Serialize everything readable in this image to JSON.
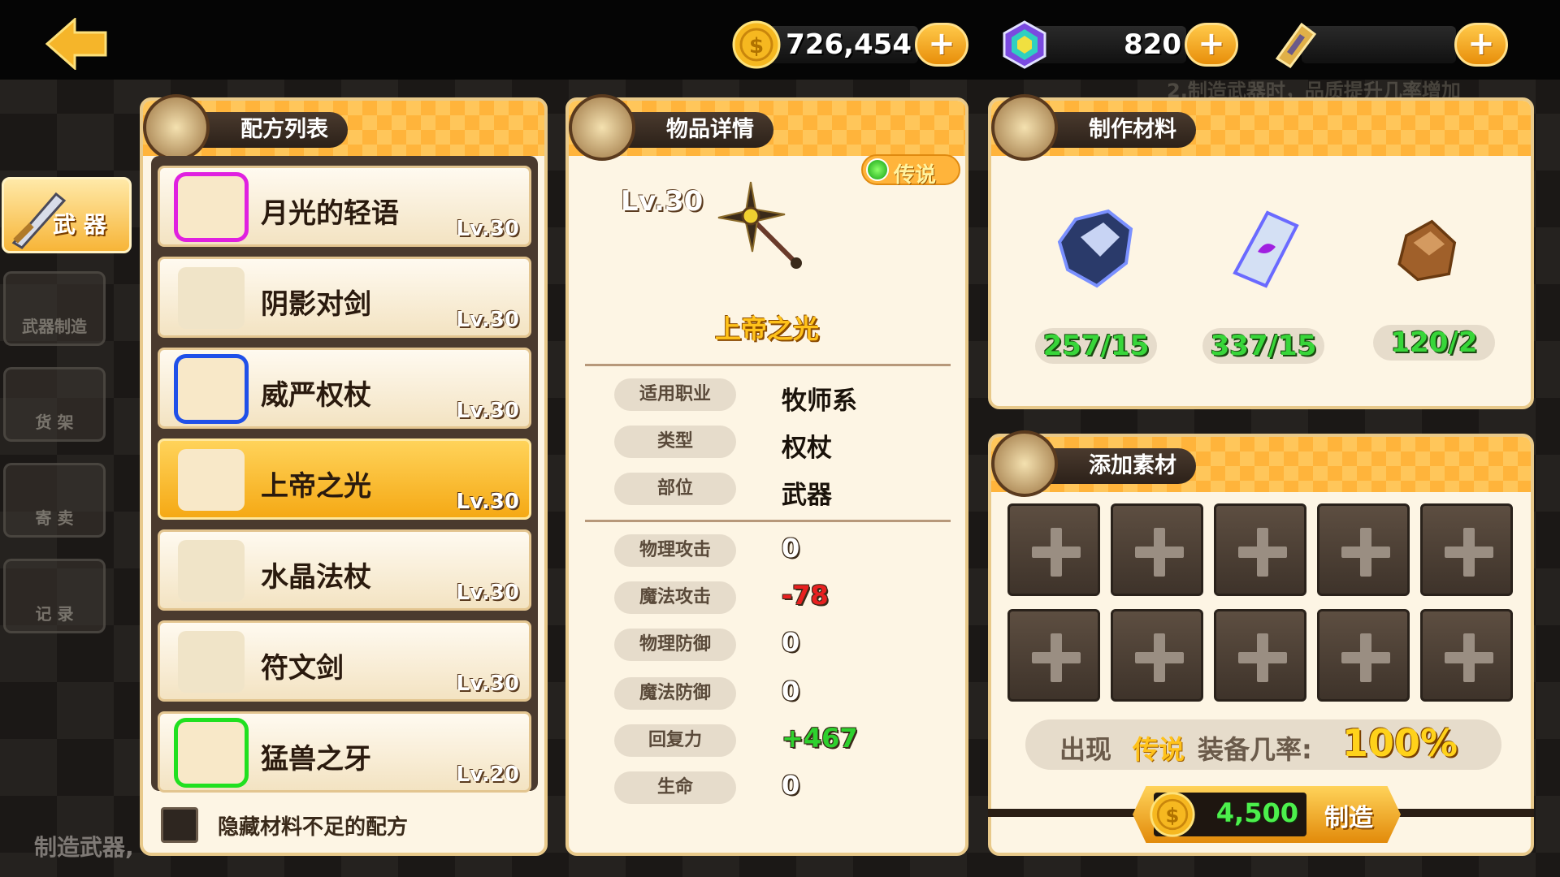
{
  "currency": {
    "gold": "726,454",
    "gems": "820",
    "tickets": "0",
    "plus": "+"
  },
  "sidebar": {
    "items": [
      {
        "label": "武 器",
        "active": true
      },
      {
        "label": "武器制造"
      },
      {
        "label": "货 架"
      },
      {
        "label": "寄 卖"
      },
      {
        "label": "记 录"
      }
    ]
  },
  "recipes": {
    "title": "配方列表",
    "items": [
      {
        "name": "月光的轻语",
        "lv": "Lv.30"
      },
      {
        "name": "阴影对剑",
        "lv": "Lv.30"
      },
      {
        "name": "威严权杖",
        "lv": "Lv.30"
      },
      {
        "name": "上帝之光",
        "lv": "Lv.30"
      },
      {
        "name": "水晶法杖",
        "lv": "Lv.30"
      },
      {
        "name": "符文剑",
        "lv": "Lv.30"
      },
      {
        "name": "猛兽之牙",
        "lv": "Lv.20"
      }
    ],
    "hide_label": "隐藏材料不足的配方"
  },
  "detail": {
    "title": "物品详情",
    "level": "Lv.30",
    "rarity": "传说",
    "item_name": "上帝之光",
    "attrs": [
      {
        "label": "适用职业",
        "value": "牧师系"
      },
      {
        "label": "类型",
        "value": "权杖"
      },
      {
        "label": "部位",
        "value": "武器"
      }
    ],
    "stats": [
      {
        "label": "物理攻击",
        "value": "0"
      },
      {
        "label": "魔法攻击",
        "value": "-78"
      },
      {
        "label": "物理防御",
        "value": "0"
      },
      {
        "label": "魔法防御",
        "value": "0"
      },
      {
        "label": "回复力",
        "value": "+467"
      },
      {
        "label": "生命",
        "value": "0"
      }
    ]
  },
  "materials": {
    "title": "制作材料",
    "items": [
      {
        "count": "257/15"
      },
      {
        "count": "337/15"
      },
      {
        "count": "120/2"
      }
    ]
  },
  "addons": {
    "title": "添加素材",
    "chance_prefix": "出现",
    "chance_rarity": "传说",
    "chance_mid": "装备几率:",
    "chance_value": "100%",
    "cost": "4,500",
    "craft_label": "制造"
  },
  "background": {
    "bottom_text": "制造武器,",
    "banner_text": "2.制造武器时，品质提升几率增加"
  },
  "colors": {
    "accent": "#f5a915",
    "legend_green": "#38d63a",
    "negative_red": "#e82020",
    "positive_green": "#2ed12e"
  }
}
